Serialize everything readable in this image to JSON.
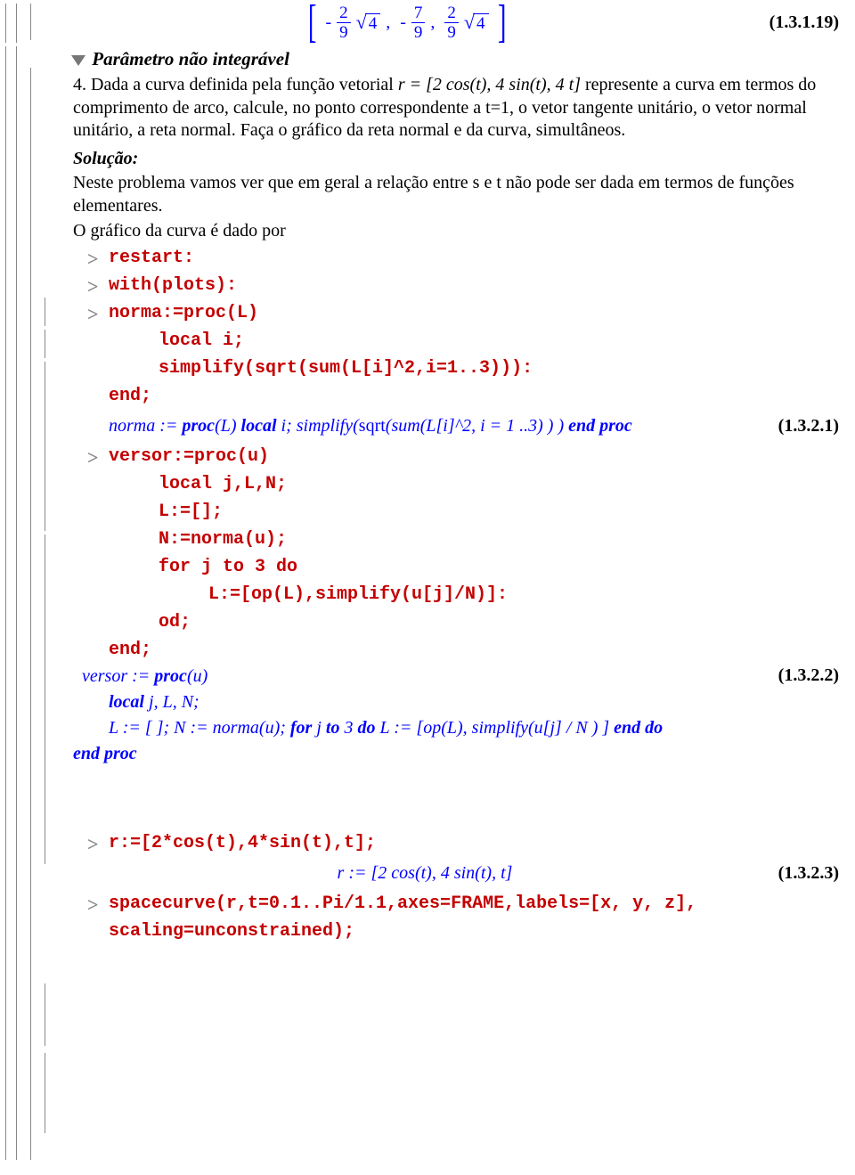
{
  "eq_top": {
    "t1_minus": "-",
    "t1_num": "2",
    "t1_den": "9",
    "t1_sqrt": "4",
    "t2_minus": "-",
    "t2_num": "7",
    "t2_den": "9",
    "t3_num": "2",
    "t3_den": "9",
    "t3_sqrt": "4",
    "label": "(1.3.1.19)"
  },
  "section": {
    "title": "Parâmetro não integrável",
    "problem_html_a": "4. Dada a curva definida pela função vetorial ",
    "problem_math": "r = [2 cos(t), 4 sin(t), 4 t]",
    "problem_html_b": " represente a curva em termos do comprimento de arco, calcule, no ponto correspondente a t=1, o vetor tangente unitário, o vetor normal unitário, a reta normal. Faça o gráfico da reta normal e da curva, simultâneos.",
    "solucao": "Solução:",
    "sol_text1": "Neste problema vamos ver que em geral a relação entre s e t não pode ser dada em termos de funções elementares.",
    "sol_text2": "O gráfico da curva é dado por",
    "cmds": {
      "restart": "restart:",
      "withplots": "with(plots):",
      "norma_head": "norma:=proc(L)",
      "norma_l1": "local i;",
      "norma_l2": "simplify(sqrt(sum(L[i]^2,i=1..3))):",
      "norma_end": "end;",
      "norma_out": "norma := proc(L) local i; simplify(sqrt(sum(L[i]^2, i = 1 ..3) ) ) end proc",
      "norma_label": "(1.3.2.1)",
      "versor_head": "versor:=proc(u)",
      "versor_l1": "local j,L,N;",
      "versor_l2": "L:=[];",
      "versor_l3": "N:=norma(u);",
      "versor_l4": "for j to 3 do",
      "versor_l5": "L:=[op(L),simplify(u[j]/N)]:",
      "versor_l6": "od;",
      "versor_end": "end;",
      "versor_out1": "versor := proc(u)",
      "versor_out2": "local j, L, N;",
      "versor_out3": "L := [ ]; N := norma(u); for j to 3 do L := [op(L), simplify(u[j] / N ) ] end do",
      "versor_out4": "end proc",
      "versor_label": "(1.3.2.2)",
      "r_cmd": "r:=[2*cos(t),4*sin(t),t];",
      "r_out": "r := [2 cos(t), 4 sin(t), t]",
      "r_label": "(1.3.2.3)",
      "space_l1": "spacecurve(r,t=0.1..Pi/1.1,axes=FRAME,labels=[x, y, z],",
      "space_l2": "scaling=unconstrained);"
    }
  }
}
